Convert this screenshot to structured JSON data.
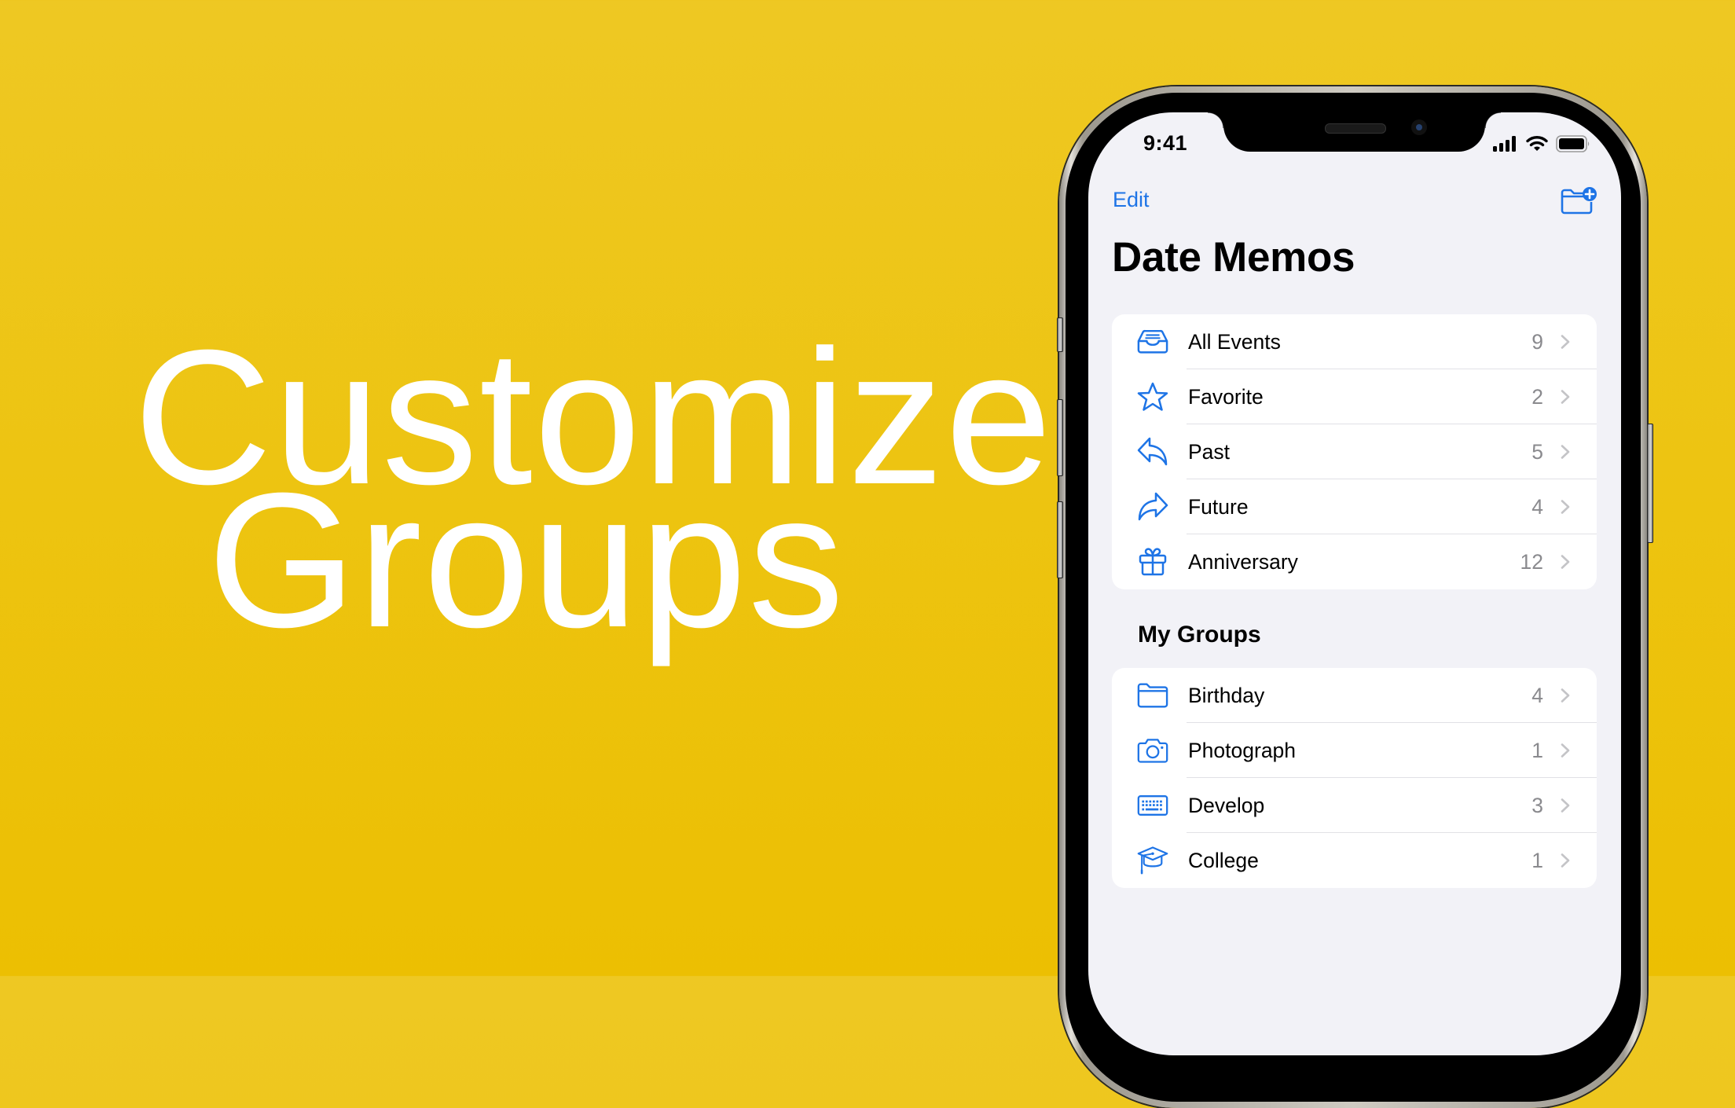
{
  "hero": {
    "line1": "Customize",
    "line2": "Groups"
  },
  "status_bar": {
    "time": "9:41",
    "icons": [
      "cellular-signal-icon",
      "wifi-icon",
      "battery-icon"
    ]
  },
  "nav": {
    "edit_label": "Edit",
    "new_folder_icon": "folder-badge-plus-icon"
  },
  "page_title": "Date Memos",
  "smart_lists": [
    {
      "label": "All Events",
      "count": "9",
      "icon": "tray-icon"
    },
    {
      "label": "Favorite",
      "count": "2",
      "icon": "star-icon"
    },
    {
      "label": "Past",
      "count": "5",
      "icon": "arrowshape-turn-left-icon"
    },
    {
      "label": "Future",
      "count": "4",
      "icon": "arrowshape-turn-right-icon"
    },
    {
      "label": "Anniversary",
      "count": "12",
      "icon": "gift-icon"
    }
  ],
  "my_groups": {
    "title": "My Groups",
    "items": [
      {
        "label": "Birthday",
        "count": "4",
        "icon": "folder-icon"
      },
      {
        "label": "Photograph",
        "count": "1",
        "icon": "camera-icon"
      },
      {
        "label": "Develop",
        "count": "3",
        "icon": "keyboard-icon"
      },
      {
        "label": "College",
        "count": "1",
        "icon": "graduationcap-icon"
      }
    ]
  },
  "colors": {
    "accent": "#1E74E6",
    "background_top": "#EEC823",
    "background_bottom": "#ECBF02",
    "screen_bg": "#F2F2F7"
  }
}
